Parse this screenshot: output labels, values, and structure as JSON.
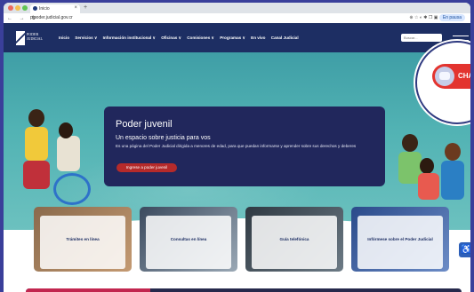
{
  "browser": {
    "tab_title": "Inicio",
    "close_glyph": "×",
    "new_tab_glyph": "+",
    "nav_glyphs": "← → ↻",
    "url": "pjpoder.judicial.gov.cr",
    "toolbar_icons": "⊕ ☆ ◐ ✱ ❐ ▣",
    "profile_label": "En pausa"
  },
  "header": {
    "logo_line1": "PODER",
    "logo_line2": "JUDICIAL",
    "menu": [
      "Inicio",
      "Servicios ∨",
      "Información institucional ∨",
      "Oficinas ∨",
      "Comisiones ∨",
      "Programas ∨",
      "En vivo",
      "Canal Judicial"
    ],
    "search_placeholder": "Buscar..."
  },
  "hero": {
    "title": "Poder juvenil",
    "subtitle": "Un espacio sobre justicia para vos",
    "description": "Es una página del Poder Judicial dirigida a menores de edad, para que puedan informarse y aprender sobre sus derechos y deberes",
    "cta": "Ingrese a poder juvenil"
  },
  "chat": {
    "label": "CHA"
  },
  "tiles": [
    {
      "label": "Trámites en línea"
    },
    {
      "label": "Consultas en línea"
    },
    {
      "label": "Guía telefónica"
    },
    {
      "label": "Infórmese sobre el Poder Judicial"
    }
  ],
  "accessibility_glyph": "♿",
  "colors": {
    "brand_navy": "#1d2e63",
    "hero_teal": "#52b3b4",
    "cta_red": "#b52a2a",
    "chat_red": "#e3342f"
  }
}
